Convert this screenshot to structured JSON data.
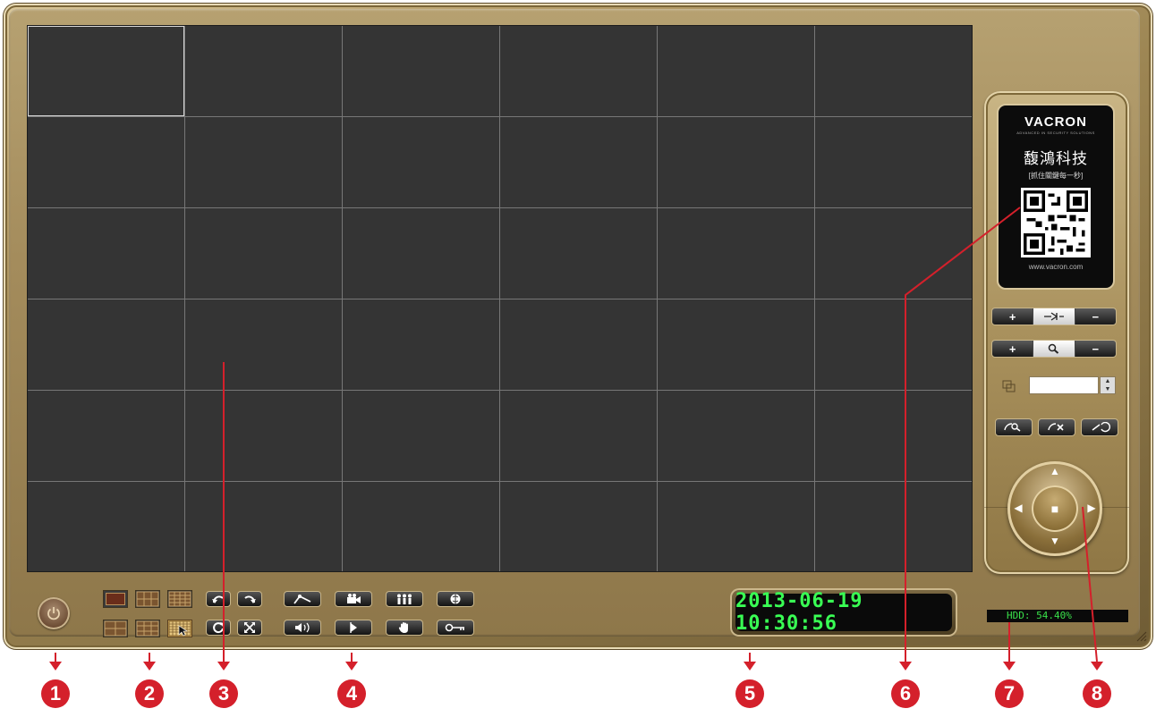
{
  "branding": {
    "brand": "VACRON",
    "tagline": "ADVANCED IN SECURITY SOLUTIONS",
    "chinese_name": "馥鴻科技",
    "slogan": "[抓住關鍵每一秒]",
    "url": "www.vacron.com"
  },
  "controls": {
    "focus": {
      "plus": "+",
      "minus": "−"
    },
    "zoom": {
      "plus": "+",
      "minus": "−"
    },
    "preset_value": "",
    "dpad": {
      "up": "▲",
      "down": "▼",
      "left": "◀",
      "right": "▶",
      "center": "■"
    }
  },
  "status": {
    "datetime": "2013-06-19 10:30:56",
    "hdd": "HDD: 54.40%"
  },
  "icons": {
    "power": "power-icon",
    "toolbar_top": [
      "rotate-left-icon",
      "rotate-right-icon",
      "settings-icon",
      "record-icon",
      "user-group-icon",
      "network-icon"
    ],
    "toolbar_bottom": [
      "refresh-icon",
      "fullscreen-icon",
      "audio-icon",
      "playback-icon",
      "hand-icon",
      "key-icon"
    ]
  },
  "markers": [
    "1",
    "2",
    "3",
    "4",
    "5",
    "6",
    "7",
    "8"
  ],
  "colors": {
    "frame_gold": "#a48c5c",
    "annotation_red": "#d4202b",
    "display_green": "#39ff54",
    "video_bg": "#343434"
  }
}
